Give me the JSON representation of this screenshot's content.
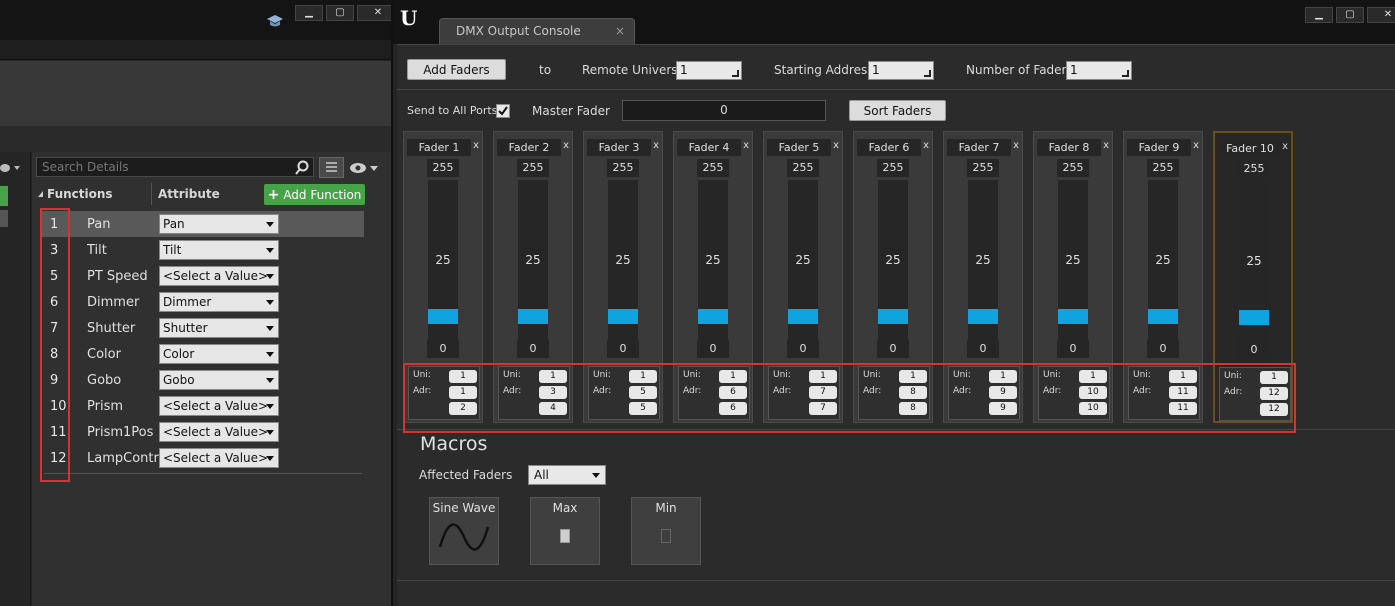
{
  "colors": {
    "accent": "#0fa4e0",
    "add_green": "#47a347",
    "highlight_red": "#d63434",
    "active_border": "#6b4f16"
  },
  "left_window": {
    "buttons": {
      "minimize": "▁",
      "maximize": "▢",
      "close": "✕"
    },
    "search_placeholder": "Search Details",
    "functions_header": "Functions",
    "attribute_header": "Attribute",
    "add_function_label": "Add Function",
    "functions": [
      {
        "num": "1",
        "name": "Pan",
        "attribute": "Pan"
      },
      {
        "num": "3",
        "name": "Tilt",
        "attribute": "Tilt"
      },
      {
        "num": "5",
        "name": "PT Speed",
        "attribute": "<Select a Value>"
      },
      {
        "num": "6",
        "name": "Dimmer",
        "attribute": "Dimmer"
      },
      {
        "num": "7",
        "name": "Shutter",
        "attribute": "Shutter"
      },
      {
        "num": "8",
        "name": "Color",
        "attribute": "Color"
      },
      {
        "num": "9",
        "name": "Gobo",
        "attribute": "Gobo"
      },
      {
        "num": "10",
        "name": "Prism",
        "attribute": "<Select a Value>"
      },
      {
        "num": "11",
        "name": "Prism1Pos",
        "attribute": "<Select a Value>"
      },
      {
        "num": "12",
        "name": "LampContro",
        "attribute": "<Select a Value>"
      }
    ]
  },
  "right_window": {
    "logo": "U",
    "tab_title": "DMX Output Console",
    "tab_close": "×",
    "add_faders_label": "Add Faders",
    "to_label": "to",
    "remote_universe_label": "Remote Universe",
    "remote_universe_value": "1",
    "starting_address_label": "Starting Address",
    "starting_address_value": "1",
    "number_of_faders_label": "Number of Faders",
    "number_of_faders_value": "1",
    "send_all_ports_label": "Send to All Ports",
    "send_all_ports_checked": true,
    "master_fader_label": "Master Fader",
    "master_fader_value": "0",
    "sort_faders_label": "Sort Faders",
    "uni_label": "Uni:",
    "adr_label": "Adr:",
    "faders": [
      {
        "name": "Fader 1",
        "max": "255",
        "mid": "25",
        "min": "0",
        "level": 0.1,
        "uni": "1",
        "adr_start": "1",
        "adr_end": "2",
        "active": false
      },
      {
        "name": "Fader 2",
        "max": "255",
        "mid": "25",
        "min": "0",
        "level": 0.1,
        "uni": "1",
        "adr_start": "3",
        "adr_end": "4",
        "active": false
      },
      {
        "name": "Fader 3",
        "max": "255",
        "mid": "25",
        "min": "0",
        "level": 0.1,
        "uni": "1",
        "adr_start": "5",
        "adr_end": "5",
        "active": false
      },
      {
        "name": "Fader 4",
        "max": "255",
        "mid": "25",
        "min": "0",
        "level": 0.1,
        "uni": "1",
        "adr_start": "6",
        "adr_end": "6",
        "active": false
      },
      {
        "name": "Fader 5",
        "max": "255",
        "mid": "25",
        "min": "0",
        "level": 0.1,
        "uni": "1",
        "adr_start": "7",
        "adr_end": "7",
        "active": false
      },
      {
        "name": "Fader 6",
        "max": "255",
        "mid": "25",
        "min": "0",
        "level": 0.1,
        "uni": "1",
        "adr_start": "8",
        "adr_end": "8",
        "active": false
      },
      {
        "name": "Fader 7",
        "max": "255",
        "mid": "25",
        "min": "0",
        "level": 0.1,
        "uni": "1",
        "adr_start": "9",
        "adr_end": "9",
        "active": false
      },
      {
        "name": "Fader 8",
        "max": "255",
        "mid": "25",
        "min": "0",
        "level": 0.1,
        "uni": "1",
        "adr_start": "10",
        "adr_end": "10",
        "active": false
      },
      {
        "name": "Fader 9",
        "max": "255",
        "mid": "25",
        "min": "0",
        "level": 0.1,
        "uni": "1",
        "adr_start": "11",
        "adr_end": "11",
        "active": false
      },
      {
        "name": "Fader 10",
        "max": "255",
        "mid": "25",
        "min": "0",
        "level": 0.1,
        "uni": "1",
        "adr_start": "12",
        "adr_end": "12",
        "active": true
      }
    ],
    "macros_title": "Macros",
    "affected_faders_label": "Affected Faders",
    "affected_faders_value": "All",
    "macros": [
      {
        "label": "Sine Wave",
        "icon": "sine-wave-icon"
      },
      {
        "label": "Max",
        "icon": "max-level-icon"
      },
      {
        "label": "Min",
        "icon": "min-level-icon"
      }
    ]
  }
}
